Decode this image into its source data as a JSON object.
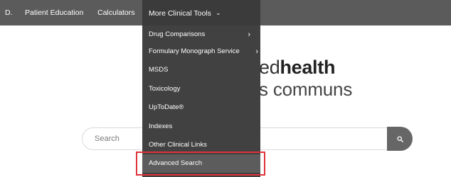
{
  "navbar": {
    "items": [
      {
        "label": "D."
      },
      {
        "label": "Patient Education"
      },
      {
        "label": "Calculators"
      },
      {
        "label": "More Clinical Tools"
      }
    ],
    "active_chevron": "⌄"
  },
  "hero": {
    "line1_prefix": "ed",
    "line1_bold": "health",
    "line2": "s communs"
  },
  "search": {
    "placeholder": "Search",
    "button_icon": "search-icon"
  },
  "dropdown": {
    "items": [
      {
        "label": "Drug Comparisons",
        "has_submenu": true
      },
      {
        "label": "Formulary Monograph Service",
        "has_submenu": true
      },
      {
        "label": "MSDS",
        "has_submenu": false
      },
      {
        "label": "Toxicology",
        "has_submenu": false
      },
      {
        "label": "UpToDate®",
        "has_submenu": false
      },
      {
        "label": "Indexes",
        "has_submenu": false
      },
      {
        "label": "Other Clinical Links",
        "has_submenu": false
      },
      {
        "label": "Advanced Search",
        "has_submenu": false,
        "highlighted": true
      }
    ],
    "submenu_arrow": "›"
  },
  "colors": {
    "navbar": "#5b5b5b",
    "dropdown": "#414141",
    "highlight": "#e0333a",
    "search_button": "#666666"
  }
}
